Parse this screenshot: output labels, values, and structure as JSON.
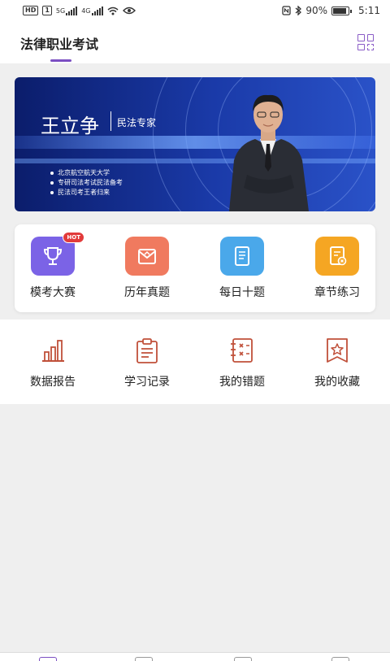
{
  "status_bar": {
    "left_chips": [
      "HD",
      "1"
    ],
    "net1": "5G",
    "net2": "4G",
    "battery_text": "90%",
    "battery_level": 0.9,
    "time": "5:11",
    "icons": [
      "wifi-icon",
      "eye-icon",
      "nfc-icon",
      "bluetooth-icon"
    ]
  },
  "header": {
    "title": "法律职业考试",
    "accent_color": "#7b4fc2",
    "menu_icon": "grid-icon"
  },
  "banner": {
    "name": "王立争",
    "subtitle": "民法专家",
    "bullets": [
      "北京航空航天大学",
      "专研司法考试民法备考",
      "民法司考王者归来"
    ]
  },
  "quick_actions": [
    {
      "label": "模考大赛",
      "icon": "trophy-icon",
      "color": "#7b63e6",
      "badge": "HOT"
    },
    {
      "label": "历年真题",
      "icon": "envelope-icon",
      "color": "#f07a5f",
      "badge": ""
    },
    {
      "label": "每日十题",
      "icon": "tablet-icon",
      "color": "#4aa8ea",
      "badge": ""
    },
    {
      "label": "章节练习",
      "icon": "document-x-icon",
      "color": "#f5a623",
      "badge": ""
    }
  ],
  "tools": [
    {
      "label": "数据报告",
      "icon": "bar-chart-icon"
    },
    {
      "label": "学习记录",
      "icon": "clipboard-icon"
    },
    {
      "label": "我的错题",
      "icon": "notebook-x-icon"
    },
    {
      "label": "我的收藏",
      "icon": "bookmark-star-icon"
    }
  ],
  "tool_icon_color": "#c0503a"
}
